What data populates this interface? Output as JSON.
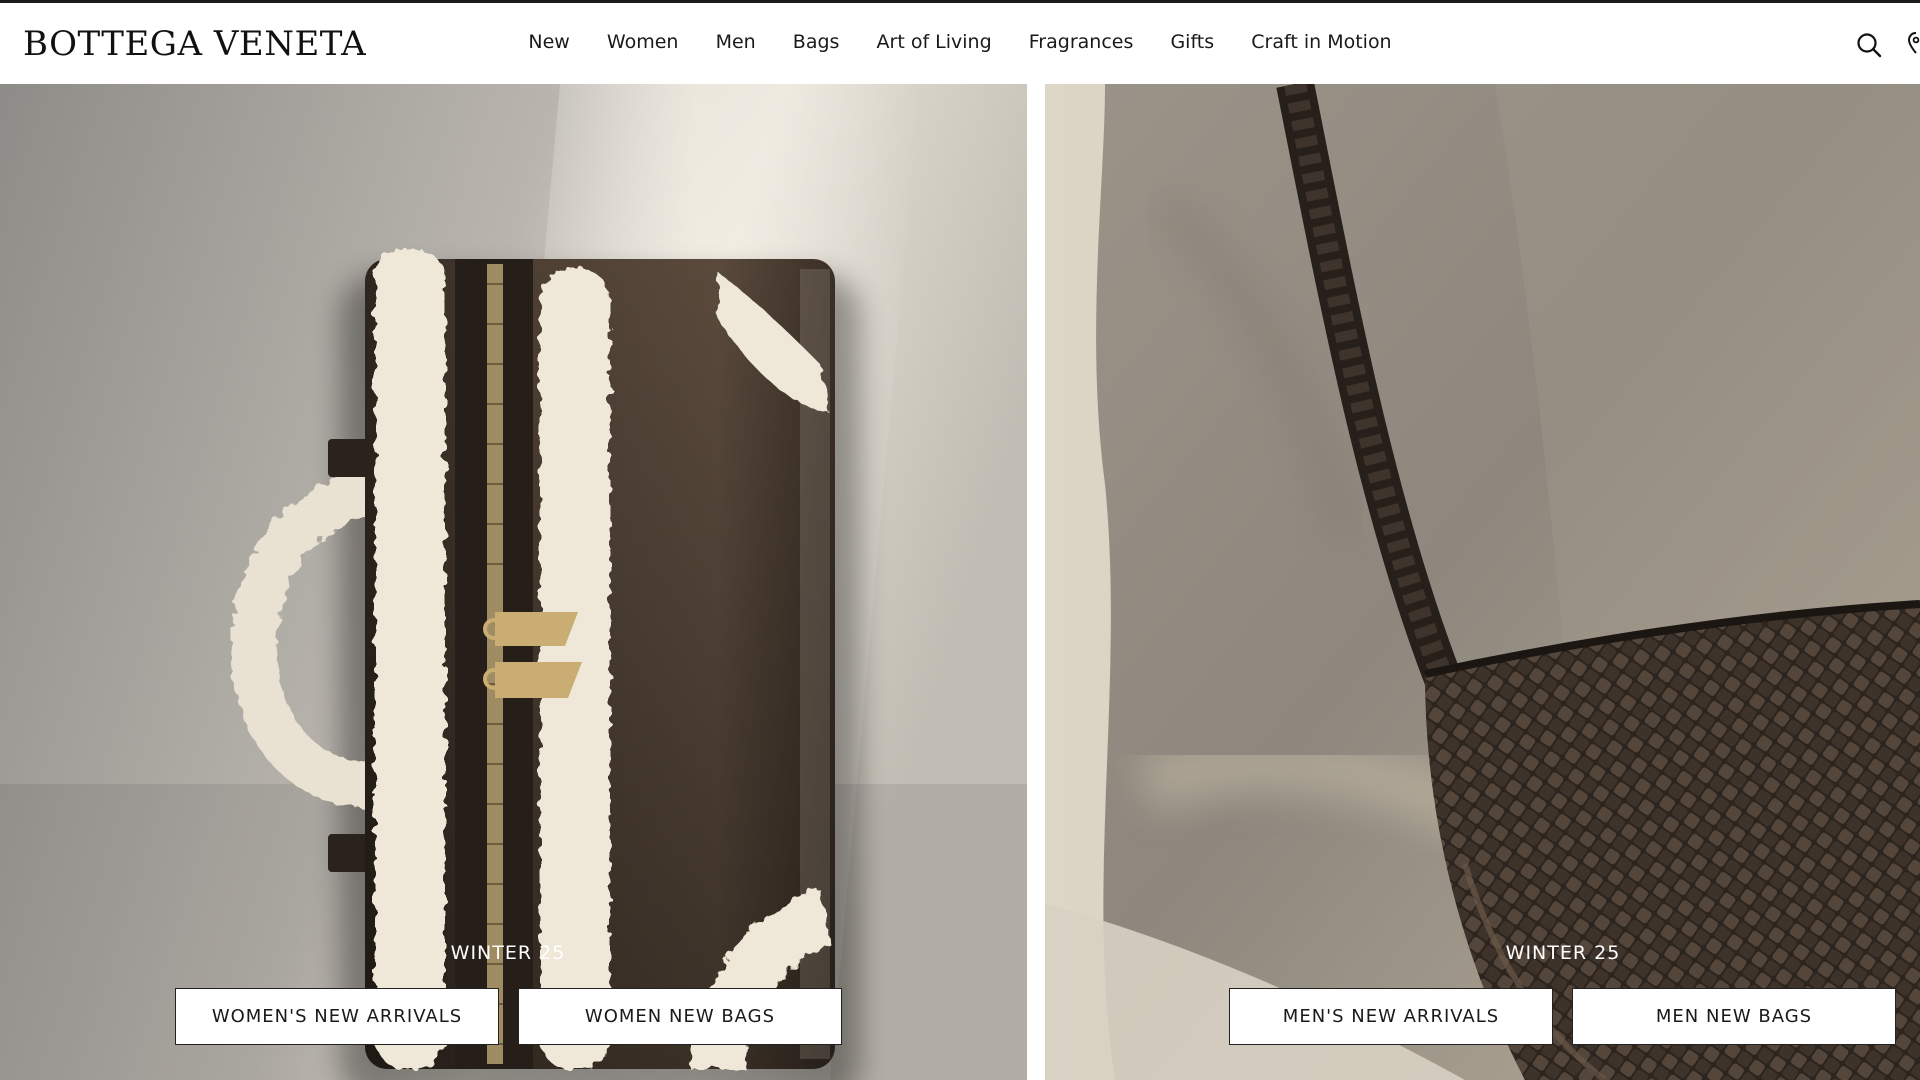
{
  "brand": {
    "name": "BOTTEGA VENETA"
  },
  "nav": {
    "items": [
      {
        "label": "New"
      },
      {
        "label": "Women"
      },
      {
        "label": "Men"
      },
      {
        "label": "Bags"
      },
      {
        "label": "Art of Living"
      },
      {
        "label": "Fragrances"
      },
      {
        "label": "Gifts"
      },
      {
        "label": "Craft in Motion"
      }
    ]
  },
  "header_icons": [
    "search-icon",
    "store-locator-icon"
  ],
  "hero": {
    "women": {
      "season": "WINTER 25",
      "buttons": [
        {
          "label": "WOMEN'S NEW ARRIVALS"
        },
        {
          "label": "WOMEN NEW BAGS"
        }
      ],
      "image": "shearling-trimmed-leather-bag"
    },
    "men": {
      "season": "WINTER 25",
      "buttons": [
        {
          "label": "MEN'S NEW ARRIVALS"
        },
        {
          "label": "MEN NEW BAGS"
        }
      ],
      "image": "woven-leather-crossbody-bag"
    }
  },
  "colors": {
    "text": "#1a1a1a",
    "background": "#ffffff",
    "leather": "#4a3c30",
    "shearling": "#efe8d8"
  }
}
